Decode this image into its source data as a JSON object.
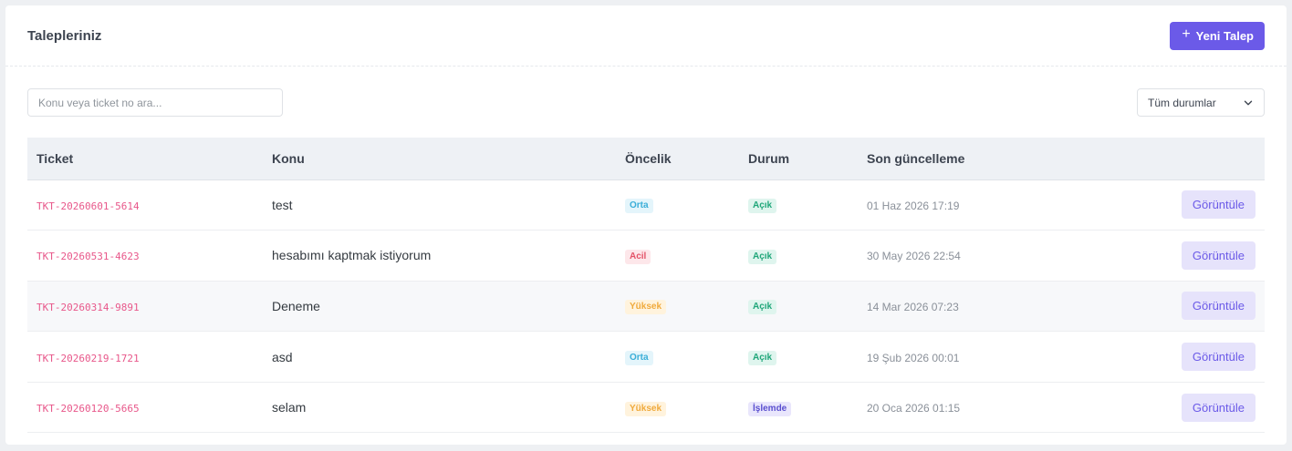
{
  "header": {
    "title": "Talepleriniz",
    "new_button_label": "Yeni Talep"
  },
  "filters": {
    "search_placeholder": "Konu veya ticket no ara...",
    "status_selected": "Tüm durumlar"
  },
  "table": {
    "columns": [
      "Ticket",
      "Konu",
      "Öncelik",
      "Durum",
      "Son güncelleme",
      ""
    ],
    "view_label": "Görüntüle",
    "rows": [
      {
        "ticket": "TKT-20260601-5614",
        "subject": "test",
        "priority": "Orta",
        "status": "Açık",
        "updated": "01 Haz 2026 17:19"
      },
      {
        "ticket": "TKT-20260531-4623",
        "subject": "hesabımı kaptmak istiyorum",
        "priority": "Acil",
        "status": "Açık",
        "updated": "30 May 2026 22:54"
      },
      {
        "ticket": "TKT-20260314-9891",
        "subject": "Deneme",
        "priority": "Yüksek",
        "status": "Açık",
        "updated": "14 Mar 2026 07:23"
      },
      {
        "ticket": "TKT-20260219-1721",
        "subject": "asd",
        "priority": "Orta",
        "status": "Açık",
        "updated": "19 Şub 2026 00:01"
      },
      {
        "ticket": "TKT-20260120-5665",
        "subject": "selam",
        "priority": "Yüksek",
        "status": "İşlemde",
        "updated": "20 Oca 2026 01:15"
      }
    ]
  },
  "colors": {
    "accent": "#6b5ae8",
    "ticket_text": "#e8578a",
    "priority_orta": "#3aaed8",
    "priority_acil": "#e45368",
    "priority_yuksek": "#f0aa3c",
    "status_acik": "#1fa679",
    "status_islemde": "#5a4fcf"
  },
  "icons": {
    "new_button": "plus-icon",
    "status_select": "chevron-down-icon"
  }
}
